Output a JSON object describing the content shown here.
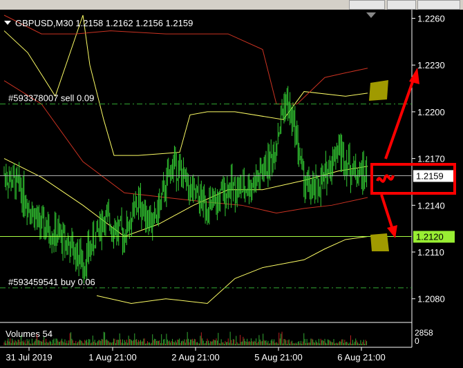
{
  "window": {
    "header": "GBPUSD,M30  1.2158  1.2162  1.2156  1.2159"
  },
  "orders": [
    {
      "label": "#593378007 sell 0.09",
      "price": 1.2205
    },
    {
      "label": "#593459541  buy 0.06",
      "price": 1.2087
    }
  ],
  "price_axis": {
    "ticks": [
      "1.2260",
      "1.2230",
      "1.2200",
      "1.2170",
      "1.2140",
      "1.2110",
      "1.2080"
    ],
    "current_price": "1.2159",
    "hline_price": "1.2120"
  },
  "volumes": {
    "label": "Volumes 54",
    "axis_top": "2858",
    "axis_bottom": "0"
  },
  "time_axis": {
    "ticks": [
      "31 Jul 2019",
      "1 Aug 21:00",
      "2 Aug 21:00",
      "5 Aug 21:00",
      "6 Aug 21:00"
    ]
  },
  "colors": {
    "candles": "#33cc33",
    "bollinger": "#ffff66",
    "envelope": "#cc3322",
    "order_line": "#33aa33",
    "hline": "#aaff44",
    "annotation": "#ff0000",
    "marker": "#a09a00"
  },
  "chart_data": {
    "type": "candlestick",
    "symbol": "GBPUSD",
    "timeframe": "M30",
    "ohlc": {
      "open": 1.2158,
      "high": 1.2162,
      "low": 1.2156,
      "close": 1.2159
    },
    "ylim": [
      1.2075,
      1.2262
    ],
    "y_ticks": [
      1.226,
      1.223,
      1.22,
      1.217,
      1.214,
      1.211,
      1.208
    ],
    "x_ticks": [
      "31 Jul 2019",
      "1 Aug 21:00",
      "2 Aug 21:00",
      "5 Aug 21:00",
      "6 Aug 21:00"
    ],
    "current_price": 1.2159,
    "horizontal_line": 1.212,
    "order_lines": [
      1.2205,
      1.2087
    ],
    "grid": false
  }
}
